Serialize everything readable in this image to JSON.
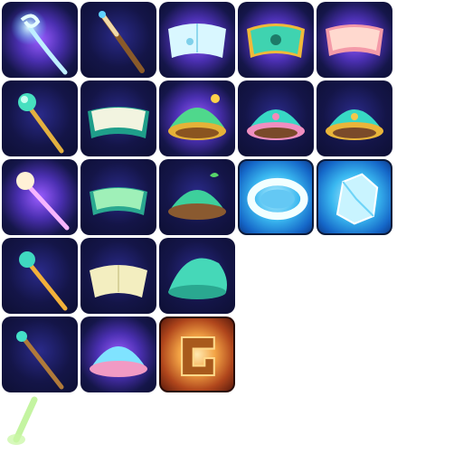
{
  "sheet": {
    "background": "#ffffff",
    "tile_background": "#141548",
    "rows": [
      [
        "spiral-staff-icon",
        "wooden-wand-icon",
        "glowing-book-icon",
        "green-gold-book-icon",
        "pink-book-icon"
      ],
      [
        "leaf-staff-icon",
        "teal-book-icon",
        "gold-crown-dome-icon",
        "pink-heart-dome-icon",
        "teal-gold-dome-icon"
      ],
      [
        "pearl-orb-staff-icon",
        "green-book-icon",
        "sprout-dome-icon",
        "ice-ring-icon",
        "ice-crystal-icon"
      ],
      [
        "teal-orb-staff-icon",
        "cream-book-icon",
        "mint-cap-icon"
      ],
      [
        "teal-wand-icon",
        "glowing-pink-dome-icon",
        "fire-rune-icon"
      ]
    ],
    "loose_sprite": "green-light-beam-icon"
  }
}
